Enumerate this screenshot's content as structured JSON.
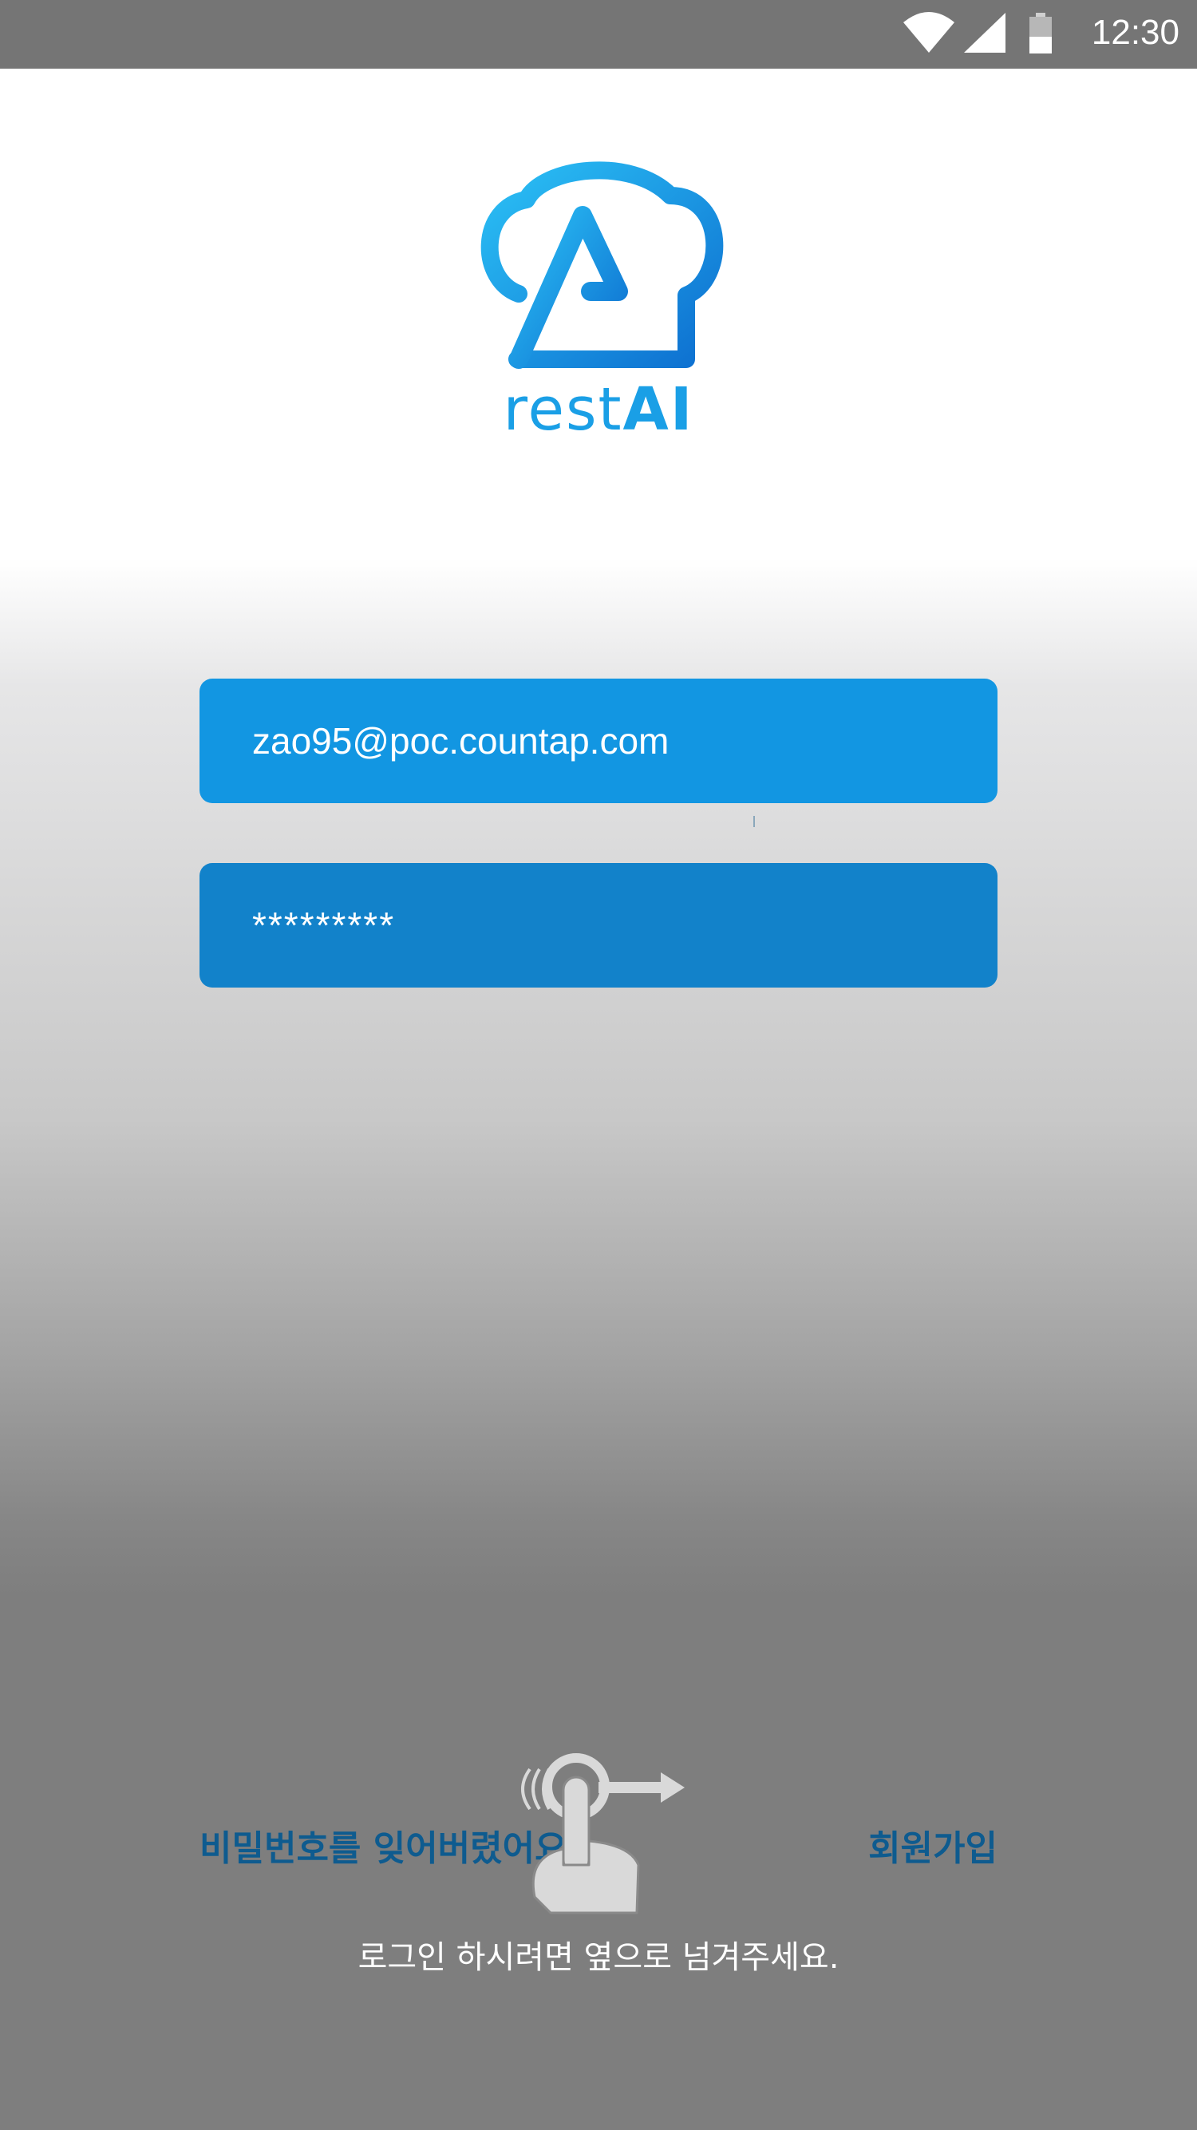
{
  "status_bar": {
    "time": "12:30",
    "icons": [
      "wifi-icon",
      "signal-icon",
      "battery-icon"
    ]
  },
  "brand": {
    "logo_icon": "chef-hat-a-logo-icon",
    "name_part1": "rest",
    "name_part2": "AI",
    "color": "#1a9fe6"
  },
  "login_form": {
    "email_value": "zao95@poc.countap.com",
    "password_value": "*********"
  },
  "links": {
    "forgot_password": "비밀번호를 잊어버렸어요",
    "sign_up": "회원가입"
  },
  "swipe_hint": {
    "icon": "swipe-hand-icon",
    "text": "로그인 하시려면 옆으로 넘겨주세요."
  },
  "colors": {
    "field_primary": "#1296e2",
    "field_secondary": "#1282ca",
    "link": "#0e5b8f",
    "status_bar": "#757575"
  }
}
